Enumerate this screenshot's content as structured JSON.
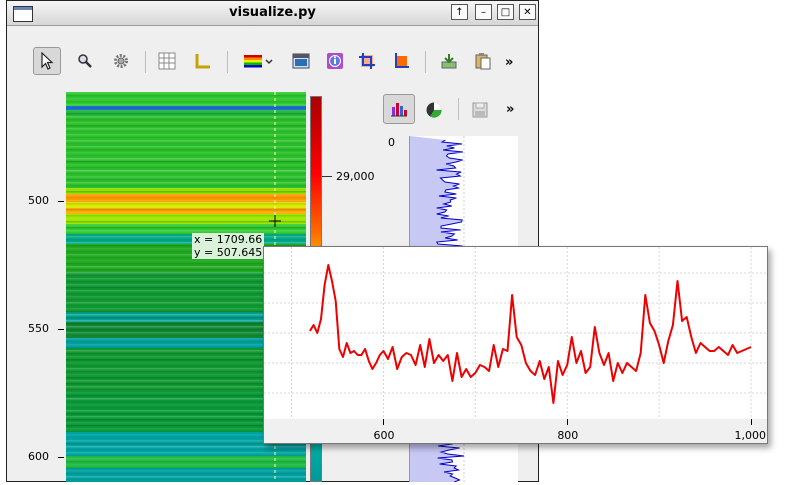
{
  "window": {
    "title": "visualize.py",
    "controls": [
      "↑",
      "–",
      "□",
      "✕"
    ]
  },
  "toolbar": {
    "overflow": "»",
    "tools": [
      {
        "name": "pointer-tool",
        "icon": "arrow-pointer-icon",
        "active": true
      },
      {
        "name": "zoom-tool",
        "icon": "magnifier-icon",
        "active": false
      },
      {
        "name": "settings-tool",
        "icon": "gear-icon",
        "active": false
      },
      {
        "name": "grid-tool",
        "icon": "grid-icon",
        "active": false
      },
      {
        "name": "axes-tool",
        "icon": "axes-icon",
        "active": false
      },
      {
        "name": "colormap-tool",
        "icon": "colormap-icon",
        "active": false
      },
      {
        "name": "save-image-tool",
        "icon": "image-icon",
        "active": false
      },
      {
        "name": "info-tool",
        "icon": "info-icon",
        "active": false
      },
      {
        "name": "crop-tool",
        "icon": "crop-icon",
        "active": false
      },
      {
        "name": "mask-tool",
        "icon": "mask-icon",
        "active": false
      },
      {
        "name": "download-tool",
        "icon": "download-icon",
        "active": false
      },
      {
        "name": "copy-tool",
        "icon": "clipboard-icon",
        "active": false
      }
    ]
  },
  "side_toolbar": {
    "overflow": "»",
    "tools": [
      {
        "name": "histogram-tool",
        "icon": "bar-chart-icon",
        "active": true
      },
      {
        "name": "pie-tool",
        "icon": "pie-chart-icon",
        "active": false
      },
      {
        "name": "save-tool",
        "icon": "floppy-icon",
        "active": false
      }
    ]
  },
  "image_view": {
    "y_ticks": [
      "500",
      "550",
      "600"
    ],
    "colorbar_label": "29,000",
    "cursor_readout": {
      "x": "x = 1709.66",
      "y": "y = 507.645"
    }
  },
  "side_plot": {
    "top_tick": "0"
  },
  "colors": {
    "accent": "#6b86b5",
    "profile_line": "#ee0000",
    "side_fill": "#c8c8f5",
    "side_line": "#0000cc"
  },
  "chart_data": {
    "type": "line",
    "series": [
      {
        "x": [
          520,
          524,
          528,
          532,
          536,
          540,
          544,
          548,
          552,
          556,
          560,
          564,
          568,
          572,
          576,
          580,
          584,
          588,
          592,
          596,
          600,
          605,
          610,
          615,
          620,
          625,
          630,
          635,
          640,
          645,
          650,
          655,
          660,
          665,
          670,
          675,
          680,
          685,
          690,
          695,
          700,
          705,
          710,
          715,
          720,
          725,
          730,
          735,
          740,
          745,
          750,
          755,
          760,
          765,
          770,
          775,
          780,
          785,
          790,
          795,
          800,
          805,
          810,
          815,
          820,
          825,
          830,
          835,
          840,
          845,
          850,
          855,
          860,
          865,
          870,
          875,
          880,
          885,
          890,
          895,
          900,
          905,
          910,
          915,
          920,
          925,
          930,
          935,
          940,
          945,
          950,
          955,
          960,
          965,
          970,
          975,
          980,
          985,
          990,
          995,
          1000
        ],
        "values": [
          4.1,
          4.4,
          4.0,
          4.7,
          6.4,
          7.4,
          6.6,
          5.6,
          3.2,
          2.8,
          3.5,
          3.0,
          3.1,
          2.9,
          2.9,
          3.2,
          2.6,
          2.2,
          2.5,
          2.9,
          3.1,
          2.7,
          3.3,
          2.2,
          2.8,
          3.0,
          2.9,
          2.4,
          3.4,
          2.3,
          3.7,
          2.5,
          2.9,
          2.6,
          2.9,
          1.6,
          3.0,
          1.8,
          2.2,
          1.8,
          2.0,
          2.4,
          2.3,
          2.1,
          3.4,
          2.3,
          3.2,
          3.1,
          5.9,
          3.8,
          3.4,
          2.5,
          2.1,
          1.9,
          2.6,
          1.7,
          2.3,
          0.5,
          2.6,
          1.9,
          2.4,
          3.8,
          2.5,
          3.1,
          2.0,
          2.3,
          4.3,
          3.0,
          2.4,
          3.0,
          1.6,
          2.5,
          2.0,
          2.5,
          2.3,
          2.1,
          3.0,
          5.9,
          4.5,
          4.1,
          3.4,
          2.5,
          3.6,
          4.4,
          6.6,
          4.6,
          4.8,
          3.8,
          3.0,
          3.5,
          3.3,
          3.1,
          3.1,
          3.3,
          3.1,
          2.9,
          3.4,
          3.0,
          3.1,
          3.2,
          3.3
        ]
      }
    ],
    "xlim": [
      470,
      1000
    ],
    "ylim": [
      0,
      8
    ],
    "x_ticks": [
      "600",
      "800",
      "1,000"
    ],
    "tick_values": [
      600,
      800,
      1000
    ],
    "grid": true
  }
}
